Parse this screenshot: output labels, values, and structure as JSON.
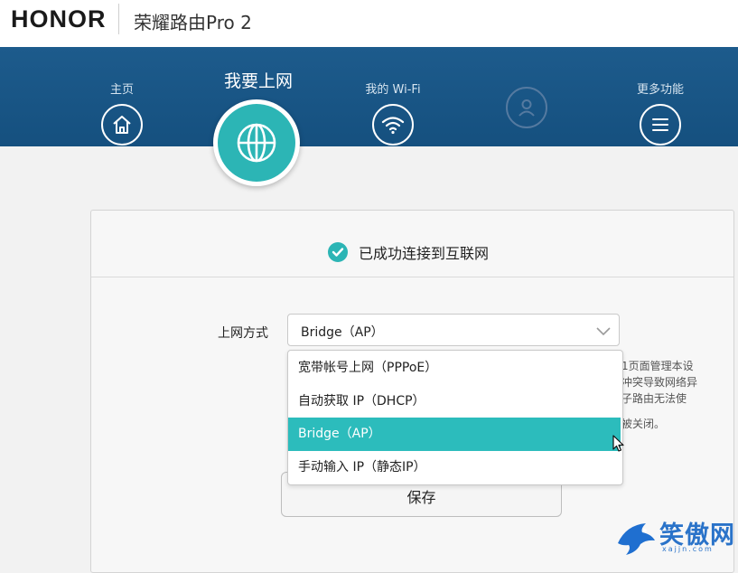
{
  "header": {
    "brand": "HONOR",
    "product": "荣耀路由Pro 2"
  },
  "nav": {
    "items": [
      {
        "label": "主页",
        "icon": "home-icon"
      },
      {
        "label": "我要上网",
        "icon": "globe-icon",
        "active": true
      },
      {
        "label": "我的 Wi-Fi",
        "icon": "wifi-icon"
      },
      {
        "label": "",
        "icon": "user-icon",
        "disabled": true
      },
      {
        "label": "更多功能",
        "icon": "menu-icon"
      }
    ]
  },
  "status": {
    "text": "已成功连接到互联网"
  },
  "form": {
    "method_label": "上网方式",
    "selected_value": "Bridge（AP）",
    "options": [
      "宽带帐号上网（PPPoE）",
      "自动获取 IP（DHCP）",
      "Bridge（AP）",
      "手动输入 IP（静态IP）"
    ],
    "hint_lines": [
      "1页面管理本设",
      "冲突导致网络异",
      "子路由无法使",
      "被关闭。"
    ],
    "save_label": "保存"
  },
  "watermark": {
    "text": "笑傲网",
    "url": "xajjn.com"
  },
  "colors": {
    "nav_band": "#1d5b8c",
    "accent_teal": "#2cb5b5",
    "selected_option": "#2cbcbc"
  }
}
